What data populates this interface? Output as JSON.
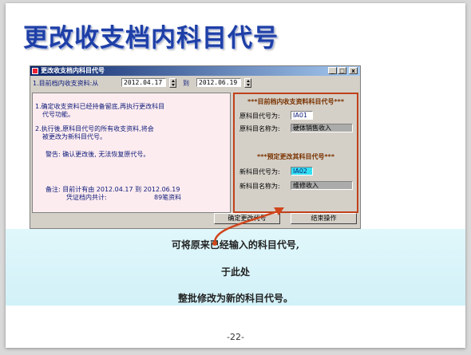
{
  "slide": {
    "title": "更改收支档内科目代号",
    "page_number": "-22-"
  },
  "window": {
    "title": "更改收支档内科目代号",
    "controls": {
      "minimize": "_",
      "maximize": "□",
      "close": "x"
    },
    "date_range": {
      "label": "1.目前档内收支资料:从",
      "from": "2012.04.17",
      "to_label": "到",
      "to": "2012.06.19"
    },
    "notes": {
      "line1a": "1.确定收支资料已经持备留底,再执行更改科目",
      "line1b": "代号功能。",
      "line2a": "2.执行後,原科目代号的所有收支资料,将会",
      "line2b": "被更改为新科目代号。",
      "warning": "警告: 确认更改後, 无法恢复原代号。",
      "remark_a": "备注: 目前计有由 2012.04.17 到 2012.06.19",
      "remark_b": "凭证档内共计:",
      "remark_count": "89笔资料"
    },
    "current_section": {
      "header": "***目前档内收支资料科目代号***",
      "code_label": "原科目代号为:",
      "code_value": "IA01",
      "name_label": "原科目名称为:",
      "name_value": "硬体销售收入"
    },
    "new_section": {
      "header": "***预定更改其科目代号***",
      "code_label": "新科目代号为:",
      "code_value": "IA02",
      "name_label": "新科目名称为:",
      "name_value": "维修收入"
    },
    "buttons": {
      "confirm": "确定更改代号",
      "end": "结束操作"
    }
  },
  "caption": {
    "line1": "可将原来已经输入的科目代号,",
    "line2": "于此处",
    "line3": "整批修改为新的科目代号。"
  },
  "colors": {
    "title": "#1e3fa6",
    "window_titlebar": "#0a246a",
    "highlight_border": "#c0401a",
    "new_code_field": "#33e0f0",
    "caption_bg": "#d2f1f8"
  }
}
